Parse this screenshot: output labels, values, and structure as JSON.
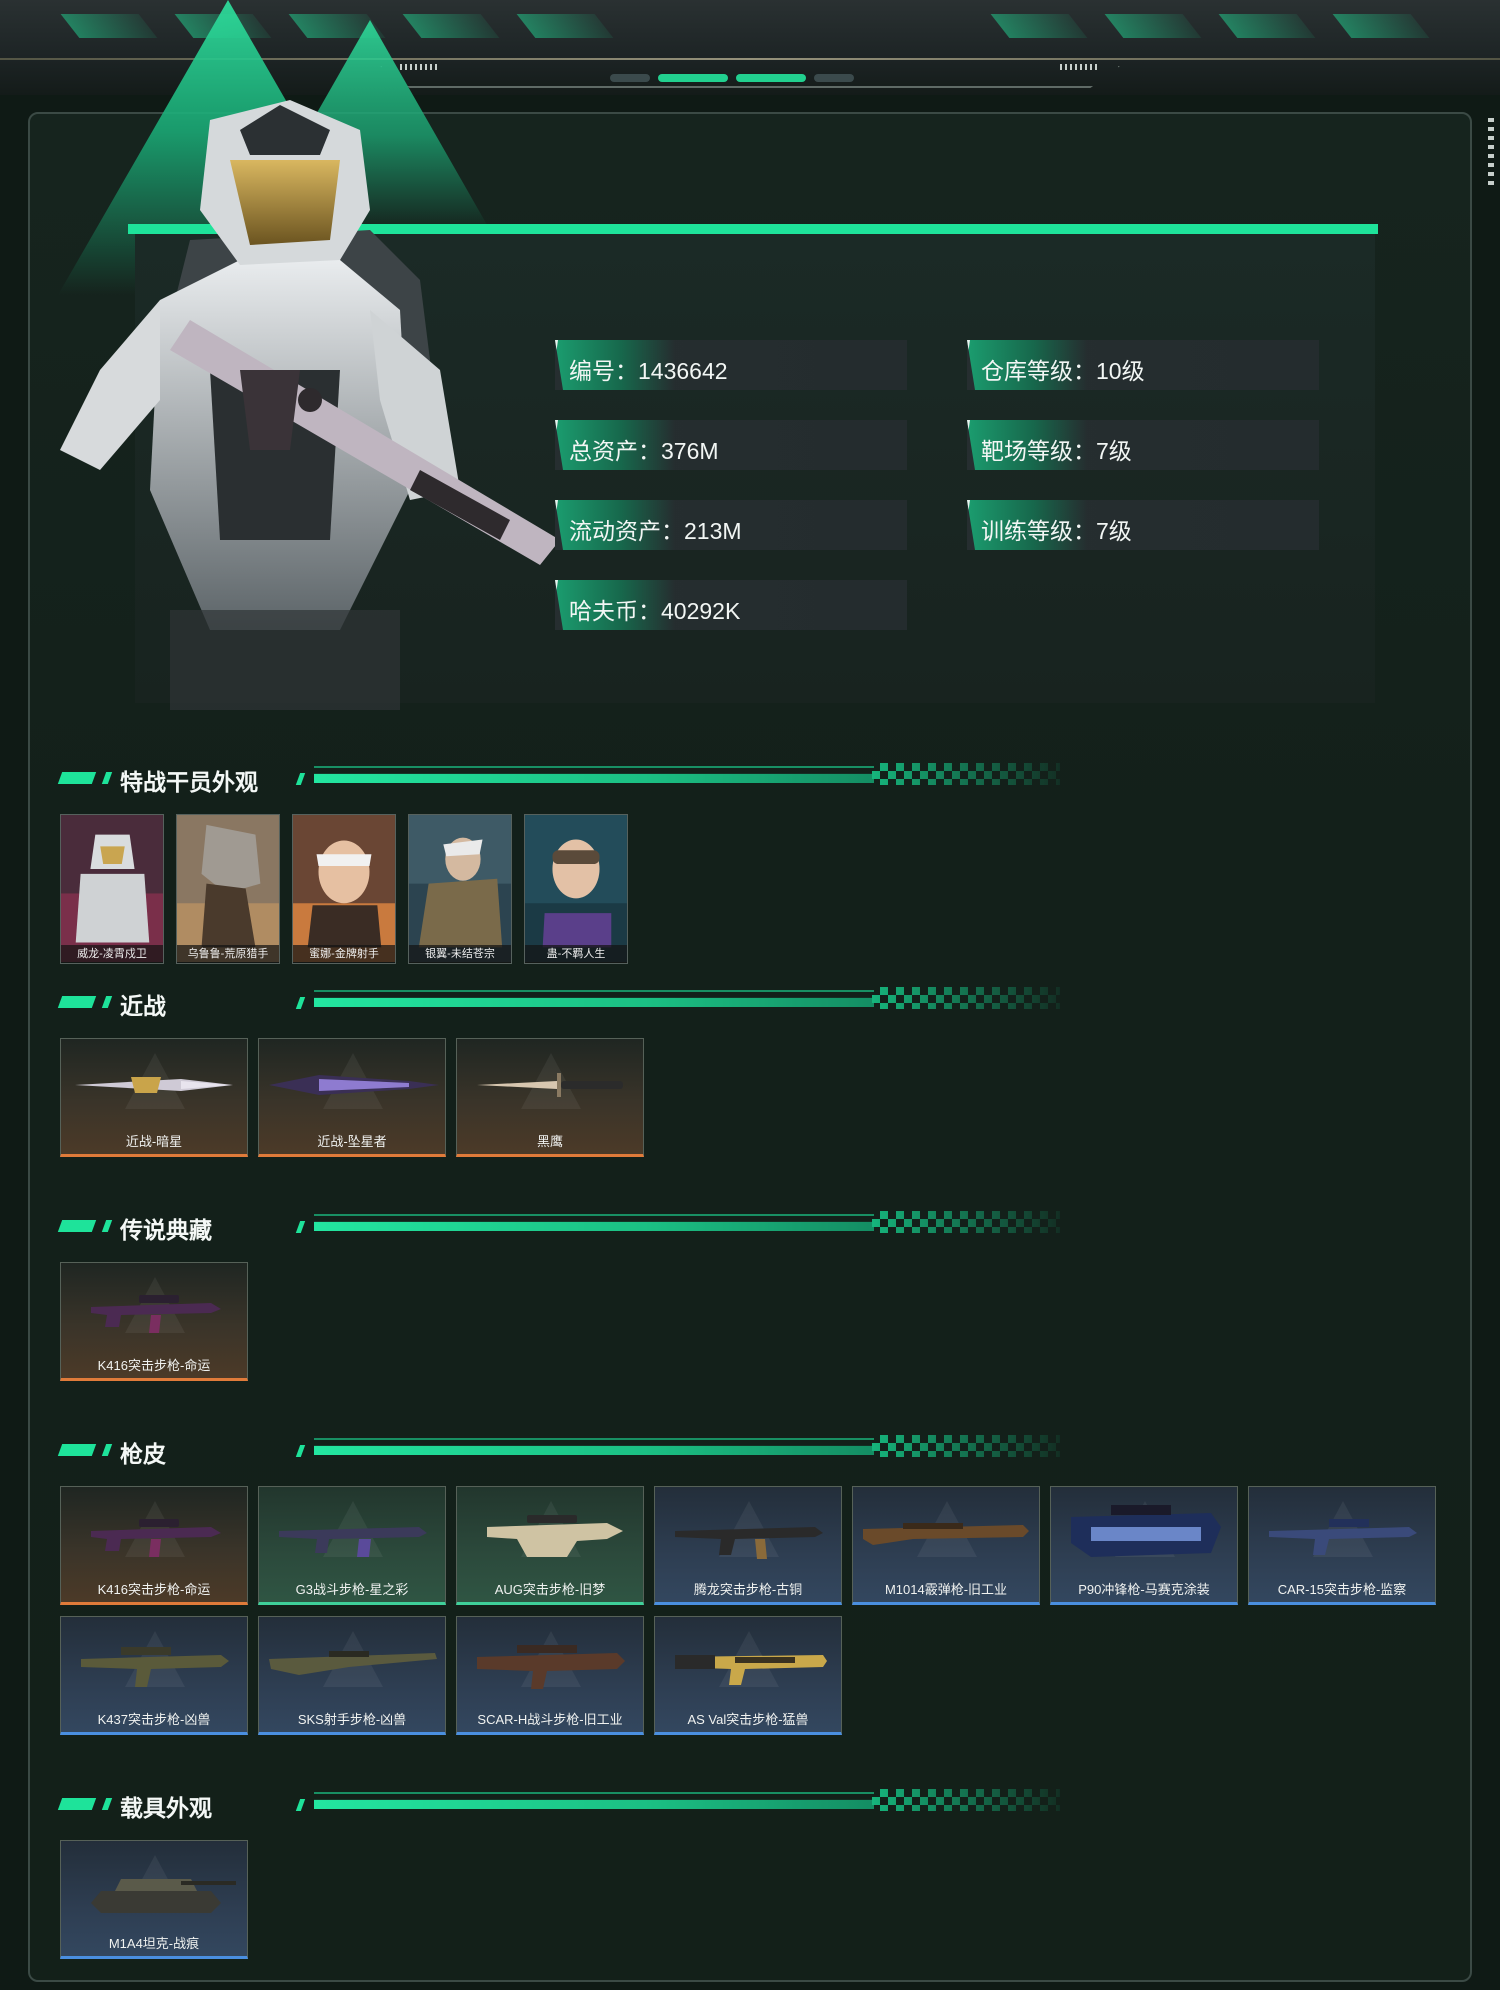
{
  "profile": {
    "stats": [
      {
        "label": "编号：1436642"
      },
      {
        "label": "仓库等级：10级"
      },
      {
        "label": "总资产：376M"
      },
      {
        "label": "靶场等级：7级"
      },
      {
        "label": "流动资产：213M"
      },
      {
        "label": "训练等级：7级"
      },
      {
        "label": "哈夫币：40292K"
      }
    ]
  },
  "sections": {
    "operators": {
      "title": "特战干员外观",
      "items": [
        {
          "label": "威龙-凌霄戍卫"
        },
        {
          "label": "乌鲁鲁-荒原猎手"
        },
        {
          "label": "蜜娜-金牌射手"
        },
        {
          "label": "银翼-未结苍宗"
        },
        {
          "label": "蛊-不羁人生"
        }
      ]
    },
    "melee": {
      "title": "近战",
      "items": [
        {
          "label": "近战-暗星",
          "tier": "orange"
        },
        {
          "label": "近战-坠星者",
          "tier": "orange"
        },
        {
          "label": "黑鹰",
          "tier": "orange"
        }
      ]
    },
    "legend": {
      "title": "传说典藏",
      "items": [
        {
          "label": "K416突击步枪-命运",
          "tier": "orange"
        }
      ]
    },
    "skins": {
      "title": "枪皮",
      "items": [
        {
          "label": "K416突击步枪-命运",
          "tier": "orange"
        },
        {
          "label": "G3战斗步枪-星之彩",
          "tier": "green"
        },
        {
          "label": "AUG突击步枪-旧梦",
          "tier": "green"
        },
        {
          "label": "腾龙突击步枪-古铜",
          "tier": "blue"
        },
        {
          "label": "M1014霰弹枪-旧工业",
          "tier": "blue"
        },
        {
          "label": "P90冲锋枪-马赛克涂装",
          "tier": "blue"
        },
        {
          "label": "CAR-15突击步枪-监察",
          "tier": "blue"
        },
        {
          "label": "K437突击步枪-凶兽",
          "tier": "blue"
        },
        {
          "label": "SKS射手步枪-凶兽",
          "tier": "blue"
        },
        {
          "label": "SCAR-H战斗步枪-旧工业",
          "tier": "blue"
        },
        {
          "label": "AS Val突击步枪-猛兽",
          "tier": "blue"
        }
      ]
    },
    "vehicles": {
      "title": "载具外观",
      "items": [
        {
          "label": "M1A4坦克-战痕",
          "tier": "blue"
        }
      ]
    }
  },
  "colors": {
    "accent": "#1ee39a",
    "tier_orange": "#e07b3a",
    "tier_green": "#3fd09a",
    "tier_blue": "#4a8fe0"
  }
}
